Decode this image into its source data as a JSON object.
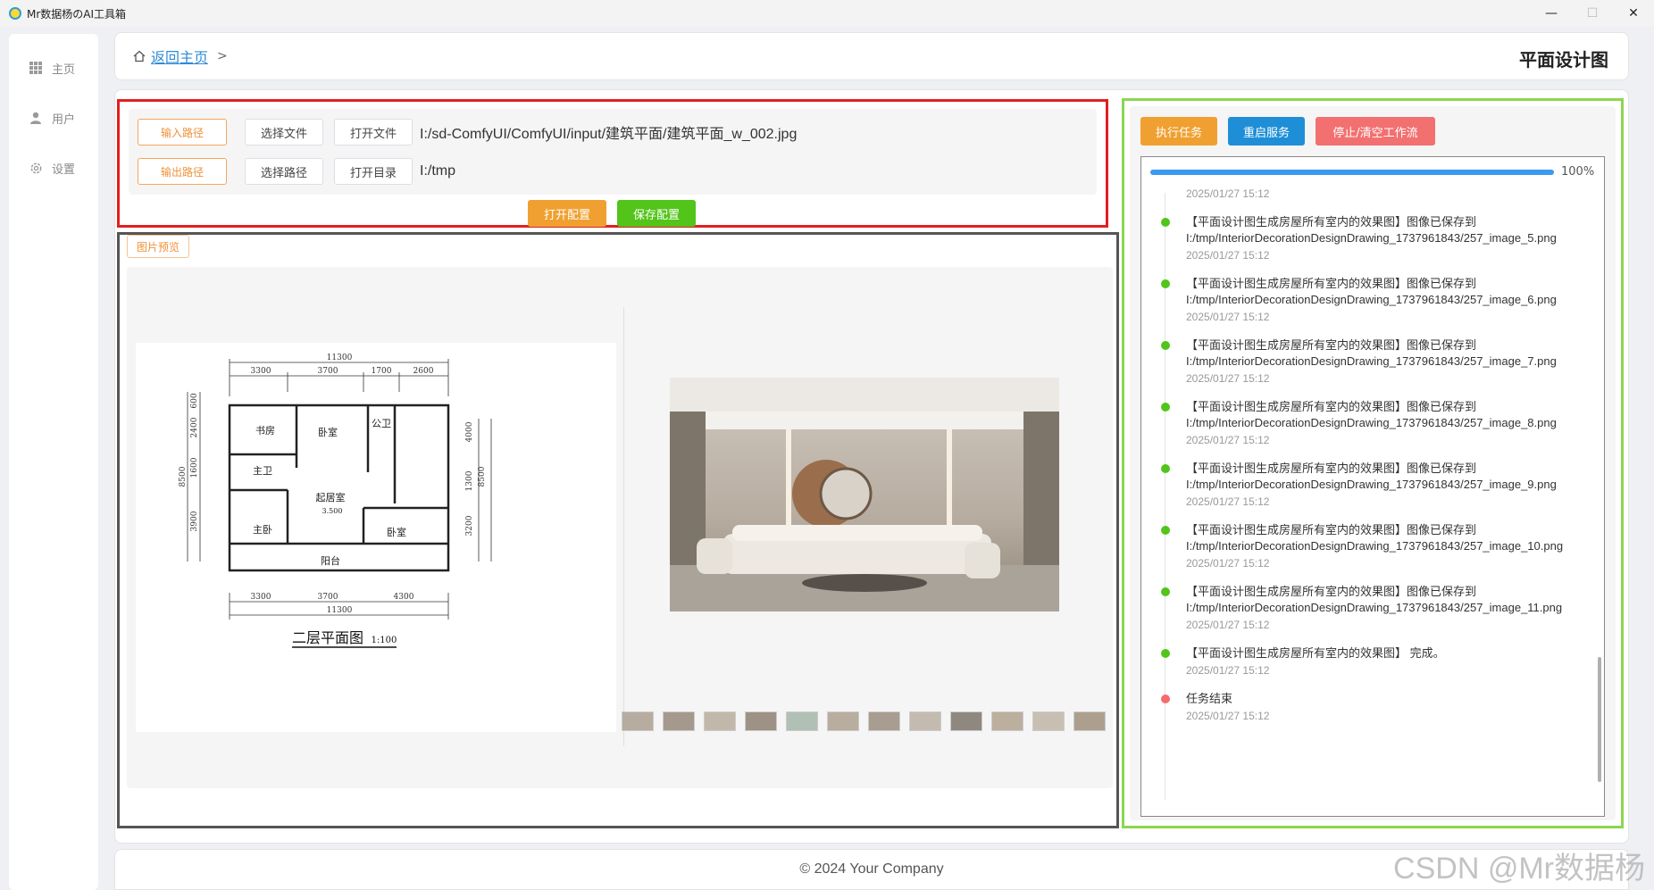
{
  "window": {
    "title": "Mr数据杨のAI工具箱",
    "minimize_label": "—",
    "maximize_label": "☐",
    "close_label": "✕"
  },
  "sidebar": {
    "items": [
      {
        "label": "主页",
        "icon": "grid-icon"
      },
      {
        "label": "用户",
        "icon": "user-icon"
      },
      {
        "label": "设置",
        "icon": "gear-icon"
      }
    ]
  },
  "header": {
    "back_label": "返回主页",
    "separator": ">",
    "page_title": "平面设计图"
  },
  "config": {
    "input_path_label": "输入路径",
    "select_file_label": "选择文件",
    "open_file_label": "打开文件",
    "input_path_value": "I:/sd-ComfyUI/ComfyUI/input/建筑平面/建筑平面_w_002.jpg",
    "output_path_label": "输出路径",
    "select_path_label": "选择路径",
    "open_dir_label": "打开目录",
    "output_path_value": "I:/tmp",
    "open_config_label": "打开配置",
    "save_config_label": "保存配置"
  },
  "preview": {
    "tag_label": "图片预览",
    "plan": {
      "caption": "二层平面图",
      "scale": "1:100",
      "dims_top_total": "11300",
      "dims_top": [
        "3300",
        "3700",
        "1700",
        "2600"
      ],
      "dims_bottom": [
        "3300",
        "3700",
        "4300"
      ],
      "dims_bottom_total": "11300",
      "dims_left": [
        "600",
        "2400",
        "1600",
        "3900"
      ],
      "dims_left_total": "8500",
      "dims_right": [
        "4000",
        "1300",
        "3200"
      ],
      "dims_right_total": "8500",
      "rooms": [
        "书房",
        "卧室",
        "公卫",
        "主卫",
        "起居室",
        "主卧",
        "卧室",
        "阳台"
      ],
      "level": "3.500"
    },
    "thumbnail_count": 12
  },
  "tasks": {
    "exec_label": "执行任务",
    "restart_label": "重启服务",
    "stop_label": "停止/清空工作流",
    "progress": 100,
    "progress_text": "100%",
    "logs": [
      {
        "msg": "",
        "ts": "2025/01/27 15:12",
        "status": "none"
      },
      {
        "msg": "【平面设计图生成房屋所有室内的效果图】图像已保存到 I:/tmp/InteriorDecorationDesignDrawing_1737961843/257_image_5.png",
        "ts": "2025/01/27 15:12",
        "status": "ok"
      },
      {
        "msg": "【平面设计图生成房屋所有室内的效果图】图像已保存到 I:/tmp/InteriorDecorationDesignDrawing_1737961843/257_image_6.png",
        "ts": "2025/01/27 15:12",
        "status": "ok"
      },
      {
        "msg": "【平面设计图生成房屋所有室内的效果图】图像已保存到 I:/tmp/InteriorDecorationDesignDrawing_1737961843/257_image_7.png",
        "ts": "2025/01/27 15:12",
        "status": "ok"
      },
      {
        "msg": "【平面设计图生成房屋所有室内的效果图】图像已保存到 I:/tmp/InteriorDecorationDesignDrawing_1737961843/257_image_8.png",
        "ts": "2025/01/27 15:12",
        "status": "ok"
      },
      {
        "msg": "【平面设计图生成房屋所有室内的效果图】图像已保存到 I:/tmp/InteriorDecorationDesignDrawing_1737961843/257_image_9.png",
        "ts": "2025/01/27 15:12",
        "status": "ok"
      },
      {
        "msg": "【平面设计图生成房屋所有室内的效果图】图像已保存到 I:/tmp/InteriorDecorationDesignDrawing_1737961843/257_image_10.png",
        "ts": "2025/01/27 15:12",
        "status": "ok"
      },
      {
        "msg": "【平面设计图生成房屋所有室内的效果图】图像已保存到 I:/tmp/InteriorDecorationDesignDrawing_1737961843/257_image_11.png",
        "ts": "2025/01/27 15:12",
        "status": "ok"
      },
      {
        "msg": "【平面设计图生成房屋所有室内的效果图】 完成。",
        "ts": "2025/01/27 15:12",
        "status": "ok"
      },
      {
        "msg": "任务结束",
        "ts": "2025/01/27 15:12",
        "status": "end"
      }
    ]
  },
  "footer": {
    "copyright": "© 2024 Your Company"
  },
  "watermark": "CSDN @Mr数据杨",
  "colors": {
    "accent_blue": "#1e8fd6",
    "warning_orange": "#f0a030",
    "success_green": "#52c41a",
    "danger_red": "#f27070",
    "config_border": "#e02020",
    "tasks_border": "#8cd650"
  }
}
